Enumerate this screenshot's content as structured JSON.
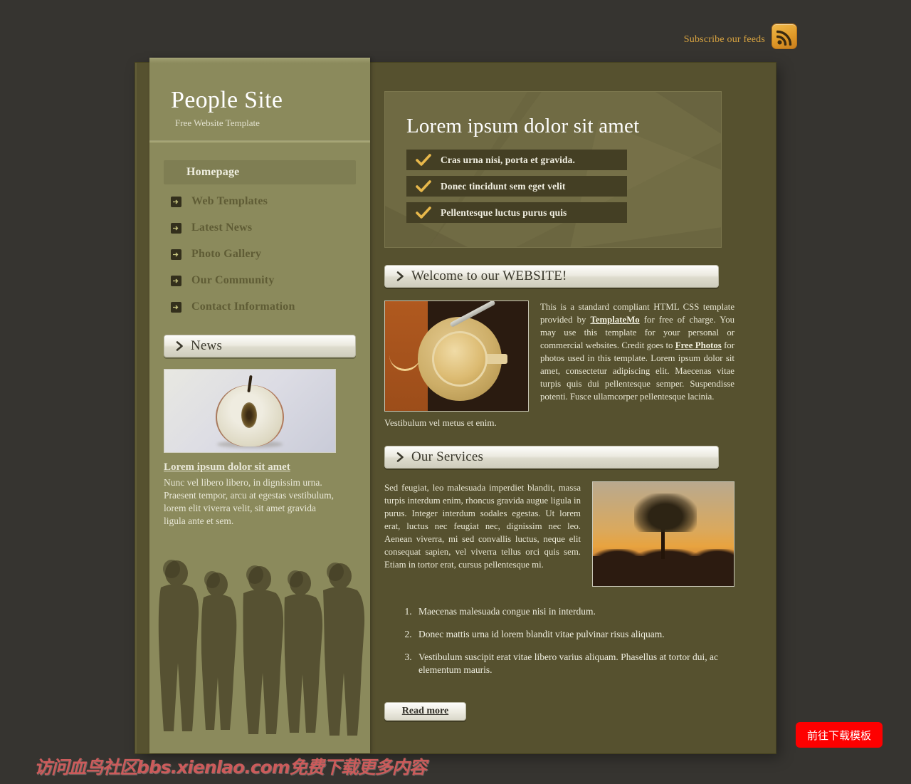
{
  "topbar": {
    "subscribe_label": "Subscribe our feeds",
    "rss_icon": "rss-icon"
  },
  "sidebar": {
    "brand": {
      "title": "People Site",
      "tagline": "Free Website Template"
    },
    "nav": [
      {
        "label": "Homepage",
        "active": true
      },
      {
        "label": "Web Templates",
        "active": false
      },
      {
        "label": "Latest News",
        "active": false
      },
      {
        "label": "Photo Gallery",
        "active": false
      },
      {
        "label": "Our Community",
        "active": false
      },
      {
        "label": "Contact Information",
        "active": false
      }
    ],
    "news": {
      "heading": "News",
      "photo_alt": "apple-cross-section-photo",
      "item_title": "Lorem ipsum dolor sit amet",
      "item_text": "Nunc vel libero libero, in dignissim urna. Praesent tempor, arcu at egestas vestibulum, lorem elit viverra velit, sit amet gravida ligula ante et sem."
    },
    "people_image_alt": "people-silhouettes-image"
  },
  "main": {
    "banner": {
      "title": "Lorem ipsum dolor sit amet",
      "items": [
        "Cras urna nisi, porta et gravida.",
        "Donec tincidunt sem eget velit",
        "Pellentesque luctus purus quis"
      ]
    },
    "welcome": {
      "heading": "Welcome to our WEBSITE!",
      "photo_alt": "coffee-cup-photo",
      "text_part1": "This is a standard compliant HTML CSS template provided by ",
      "link1": "TemplateMo",
      "text_part2": " for free of charge. You may use this template for your personal or commercial websites. Credit goes to ",
      "link2": "Free Photos",
      "text_part3": " for photos used in this template. Lorem ipsum dolor sit amet, consectetur adipiscing elit. Maecenas vitae turpis quis dui pellentesque semper. Suspendisse potenti. Fusce ullamcorper pellentesque lacinia.",
      "caption": "Vestibulum vel metus et enim."
    },
    "services": {
      "heading": "Our Services",
      "text": "Sed feugiat, leo malesuada imperdiet blandit, massa turpis interdum enim, rhoncus gravida augue ligula in purus. Integer interdum sodales egestas. Ut lorem erat, luctus nec feugiat nec, dignissim nec leo. Aenean viverra, mi sed convallis luctus, neque elit consequat sapien, vel viverra tellus orci quis sem. Etiam in tortor erat, cursus pellentesque mi.",
      "photo_alt": "sunset-tree-photo",
      "list": [
        "Maecenas malesuada congue nisi in interdum.",
        "Donec mattis urna id lorem blandit vitae pulvinar risus aliquam.",
        "Vestibulum suscipit erat vitae libero varius aliquam. Phasellus at tortor dui, ac elementum mauris."
      ],
      "read_more_label": "Read more"
    }
  },
  "overlay": {
    "watermark": "访问血鸟社区bbs.xienlao.com免费下载更多内容",
    "download_button": "前往下载模板"
  },
  "colors": {
    "page_bg": "#363430",
    "panel_bg": "#56512f",
    "sidebar_bg": "#8b8a5c",
    "banner_bg": "#6b6640",
    "accent_gold": "#d9a441",
    "check_gold": "#e8b84b",
    "download_red": "#fe0000",
    "watermark_red": "#d95f5f"
  }
}
